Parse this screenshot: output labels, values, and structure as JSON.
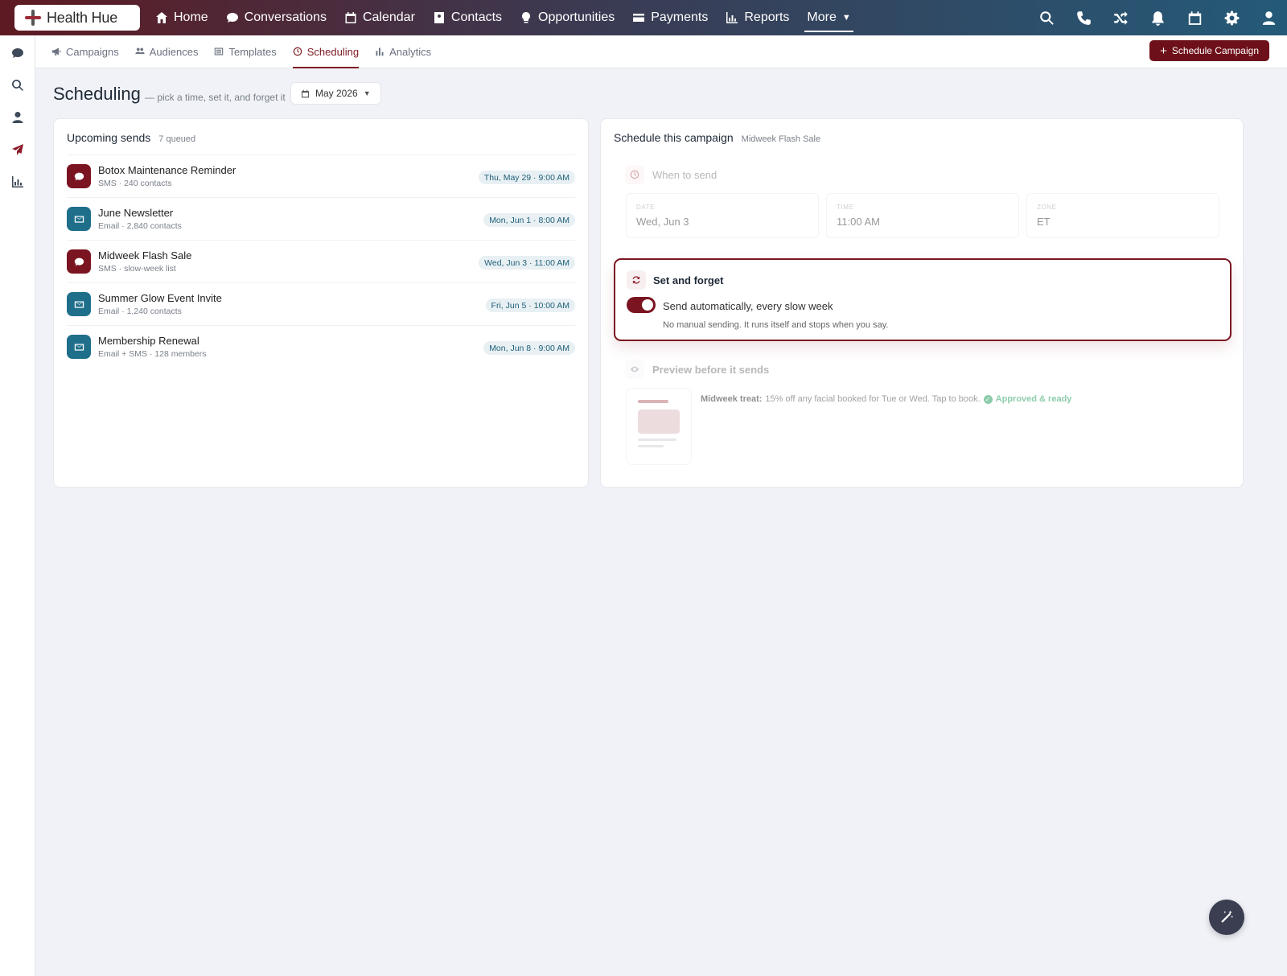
{
  "brand": {
    "name": "Health Hue"
  },
  "nav": {
    "items": [
      {
        "label": "Home",
        "icon": "home-icon"
      },
      {
        "label": "Conversations",
        "icon": "chat-bubble-icon"
      },
      {
        "label": "Calendar",
        "icon": "calendar-icon"
      },
      {
        "label": "Contacts",
        "icon": "contact-card-icon"
      },
      {
        "label": "Opportunities",
        "icon": "lightbulb-icon"
      },
      {
        "label": "Payments",
        "icon": "credit-card-icon"
      },
      {
        "label": "Reports",
        "icon": "bar-chart-icon"
      }
    ],
    "more_label": "More",
    "right_icons": [
      "search-icon",
      "phone-icon",
      "shuffle-icon",
      "bell-icon",
      "calendar-icon",
      "gear-icon",
      "user-icon"
    ]
  },
  "rail": {
    "icons": [
      "chat-bubble-icon",
      "search-icon",
      "user-icon",
      "paper-plane-icon",
      "bar-chart-icon"
    ],
    "active_index": 3
  },
  "subnav": {
    "tabs": [
      {
        "label": "Campaigns",
        "icon": "megaphone-icon"
      },
      {
        "label": "Audiences",
        "icon": "users-icon"
      },
      {
        "label": "Templates",
        "icon": "list-icon"
      },
      {
        "label": "Scheduling",
        "icon": "clock-icon",
        "active": true
      },
      {
        "label": "Analytics",
        "icon": "bar-chart-icon"
      }
    ],
    "primary_button": "Schedule Campaign"
  },
  "page": {
    "title": "Scheduling",
    "subtitle": "— pick a time, set it, and forget it",
    "month": "May 2026"
  },
  "upcoming": {
    "title": "Upcoming sends",
    "count": "7 queued",
    "rows": [
      {
        "name": "Botox Maintenance Reminder",
        "sub": "SMS · 240 contacts",
        "when": "Thu, May 29 · 9:00 AM",
        "channel": "sms"
      },
      {
        "name": "June Newsletter",
        "sub": "Email · 2,840 contacts",
        "when": "Mon, Jun 1 · 8:00 AM",
        "channel": "email"
      },
      {
        "name": "Midweek Flash Sale",
        "sub": "SMS · slow-week list",
        "when": "Wed, Jun 3 · 11:00 AM",
        "channel": "sms"
      },
      {
        "name": "Summer Glow Event Invite",
        "sub": "Email · 1,240 contacts",
        "when": "Fri, Jun 5 · 10:00 AM",
        "channel": "email"
      },
      {
        "name": "Membership Renewal",
        "sub": "Email + SMS · 128 members",
        "when": "Mon, Jun 8 · 9:00 AM",
        "channel": "email"
      }
    ]
  },
  "schedule": {
    "title": "Schedule this campaign",
    "campaign": "Midweek Flash Sale",
    "when_label": "When to send",
    "fields": [
      {
        "label": "DATE",
        "value": "Wed, Jun 3"
      },
      {
        "label": "TIME",
        "value": "11:00 AM"
      },
      {
        "label": "ZONE",
        "value": "ET"
      }
    ],
    "set_forget": {
      "title": "Set and forget",
      "toggle_label": "Send automatically, every slow week",
      "toggle_on": true,
      "help": "No manual sending. It runs itself and stops when you say."
    },
    "preview": {
      "label": "Preview before it sends",
      "lead": "Midweek treat:",
      "message": "15% off any facial booked for Tue or Wed. Tap to book.",
      "status": "Approved & ready"
    }
  },
  "colors": {
    "brand": "#6e1019",
    "sms": "#7a1420",
    "email": "#1f6f8b",
    "approved": "#1e9a57"
  }
}
